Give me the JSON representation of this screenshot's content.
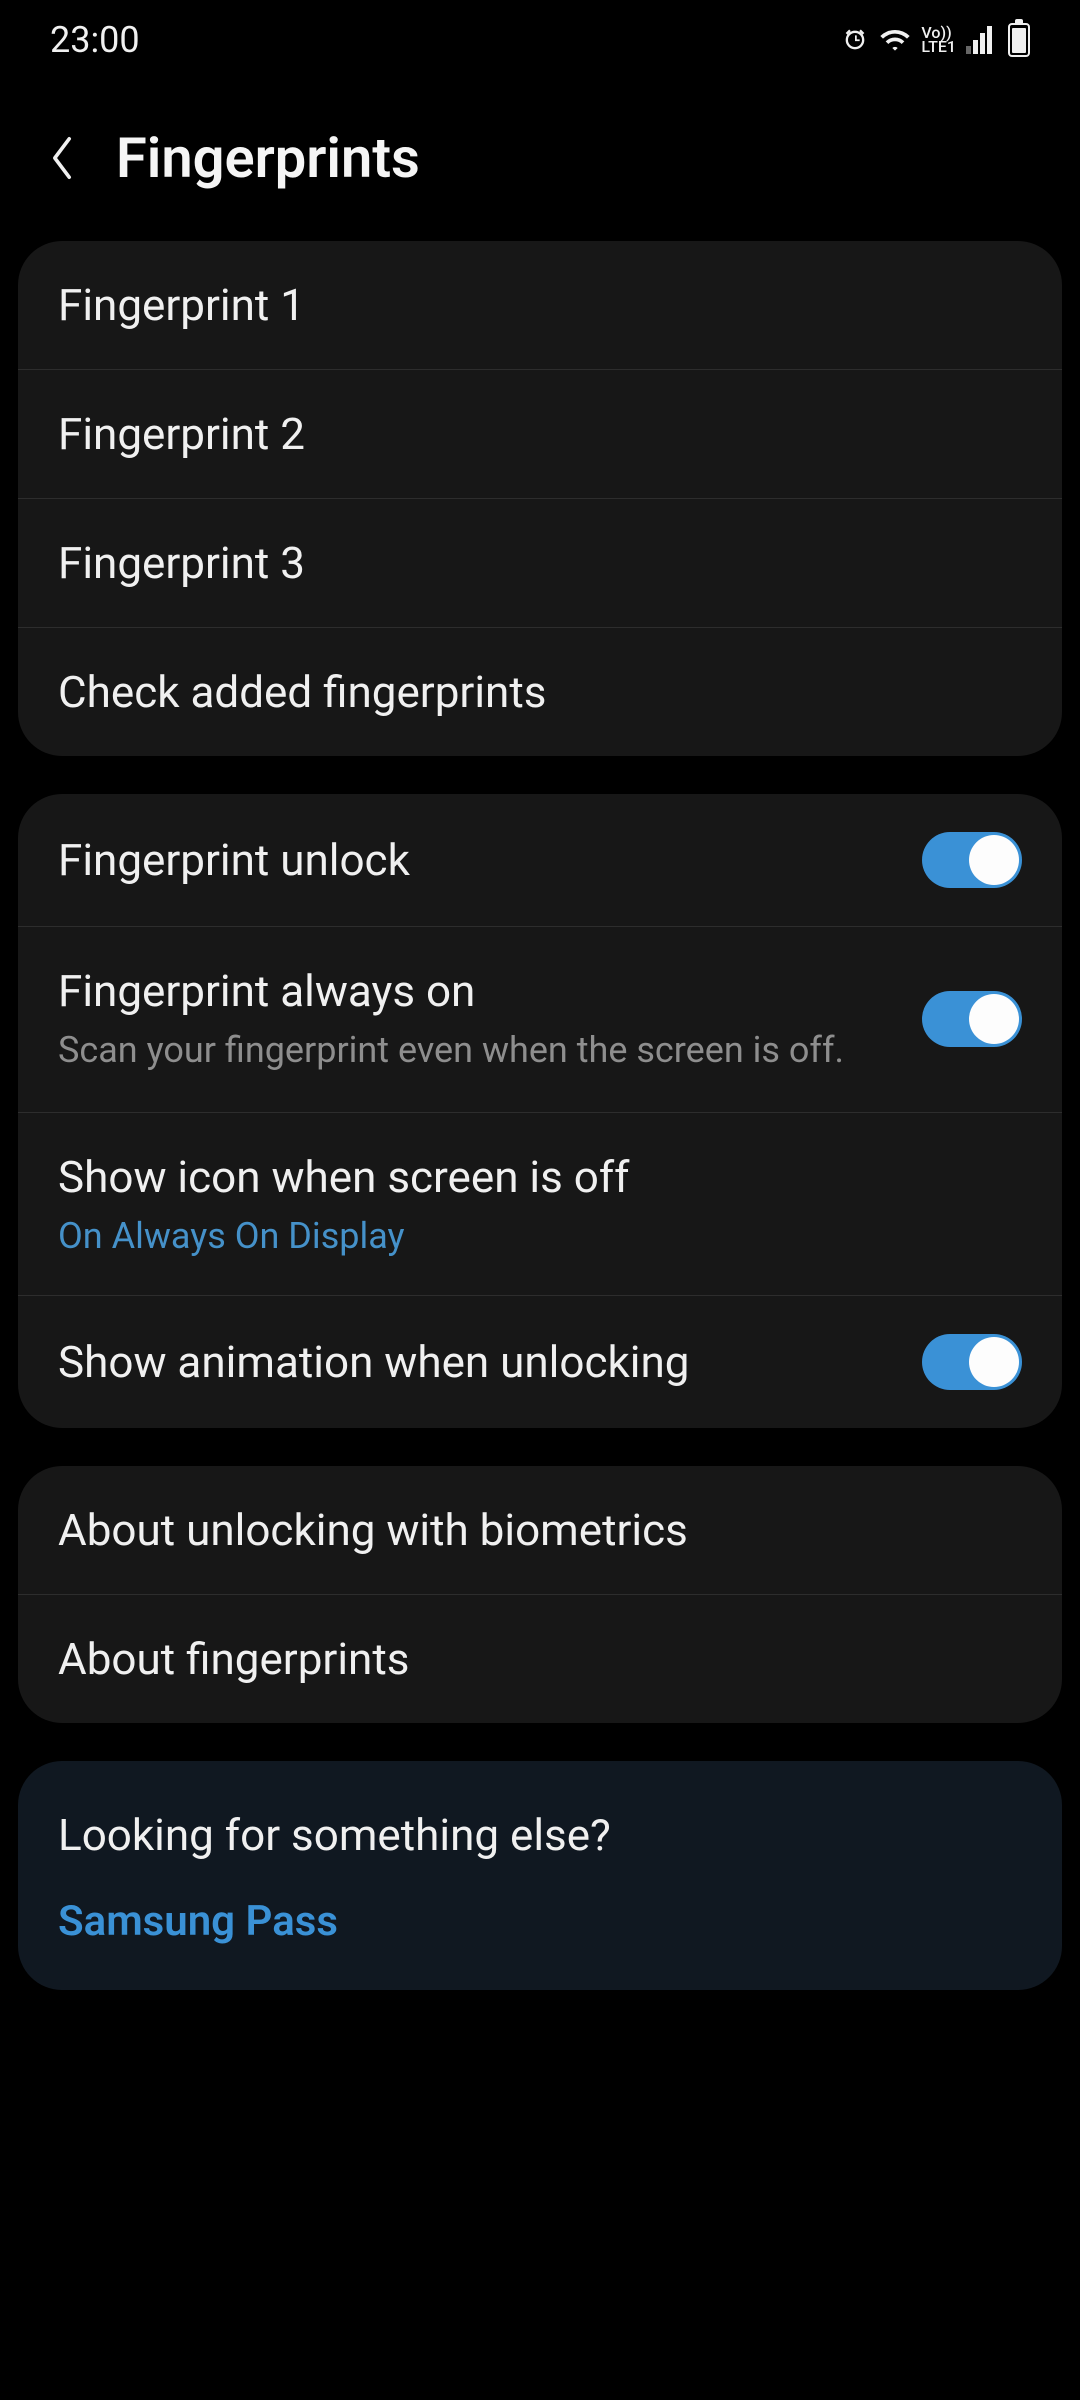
{
  "statusBar": {
    "time": "23:00",
    "lteLabel": "Vo))\nLTE1"
  },
  "header": {
    "title": "Fingerprints"
  },
  "section1": {
    "items": [
      {
        "title": "Fingerprint 1"
      },
      {
        "title": "Fingerprint 2"
      },
      {
        "title": "Fingerprint 3"
      },
      {
        "title": "Check added fingerprints"
      }
    ]
  },
  "section2": {
    "items": [
      {
        "title": "Fingerprint unlock",
        "toggle": true
      },
      {
        "title": "Fingerprint always on",
        "subtitle": "Scan your fingerprint even when the screen is off.",
        "toggle": true
      },
      {
        "title": "Show icon when screen is off",
        "linkSubtitle": "On Always On Display"
      },
      {
        "title": "Show animation when unlocking",
        "toggle": true
      }
    ]
  },
  "section3": {
    "items": [
      {
        "title": "About unlocking with biometrics"
      },
      {
        "title": "About fingerprints"
      }
    ]
  },
  "footer": {
    "title": "Looking for something else?",
    "link": "Samsung Pass"
  }
}
